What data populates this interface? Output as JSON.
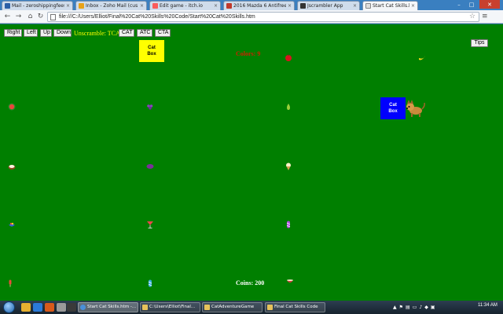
{
  "browser": {
    "tabs": [
      {
        "label": "Mail - zeroshippingfees",
        "color": "#2b5fa6",
        "active": false
      },
      {
        "label": "Inbox - Zoho Mail (cus",
        "color": "#e8a31a",
        "active": false
      },
      {
        "label": "Edit game - itch.io",
        "color": "#fa5c5c",
        "active": false
      },
      {
        "label": "2016 Mazda 6 Antifreeze",
        "color": "#c0392b",
        "active": false
      },
      {
        "label": "Jscrambler App",
        "color": "#333333",
        "active": false
      },
      {
        "label": "Start Cat Skills.htm",
        "color": "#cccccc",
        "active": true
      }
    ],
    "url": "file:///C:/Users/Elliot/Final%20Cat%20Skills%20Code/Start%20Cat%20Skills.htm"
  },
  "game": {
    "buttons": {
      "right": "Right",
      "left": "Left",
      "up": "Up",
      "down": "Down",
      "cat": "CAT",
      "atc": "ATC",
      "cta": "CTA",
      "tips": "Tips"
    },
    "unscramble": "Unscramble: TCA",
    "catbox_top": [
      "Cat",
      "Box"
    ],
    "catbox_right": [
      "Cat",
      "Box"
    ],
    "colors_label": "Colors: 9",
    "coins_label": "Coins: 200",
    "items": [
      "apple-icon",
      "banana-icon",
      "watermelon-icon",
      "grapes-icon",
      "pear-icon",
      "coconut-icon",
      "plum-icon",
      "ice-cream-icon",
      "bowl-icon",
      "drink-icon",
      "candy-icon",
      "popsicle-icon",
      "candy-icon",
      "bowl-icon"
    ]
  },
  "taskbar": {
    "tasks": [
      {
        "label": "Start Cat Skills.htm -...",
        "color": "#4a90d9",
        "active": true
      },
      {
        "label": "C:\\Users\\Elliot\\Final...",
        "color": "#e6c25a",
        "active": false
      },
      {
        "label": "CatAdventureGame",
        "color": "#e6c25a",
        "active": false
      },
      {
        "label": "Final Cat Skills Code",
        "color": "#e6c25a",
        "active": false
      }
    ],
    "clock": "11:34 AM"
  }
}
